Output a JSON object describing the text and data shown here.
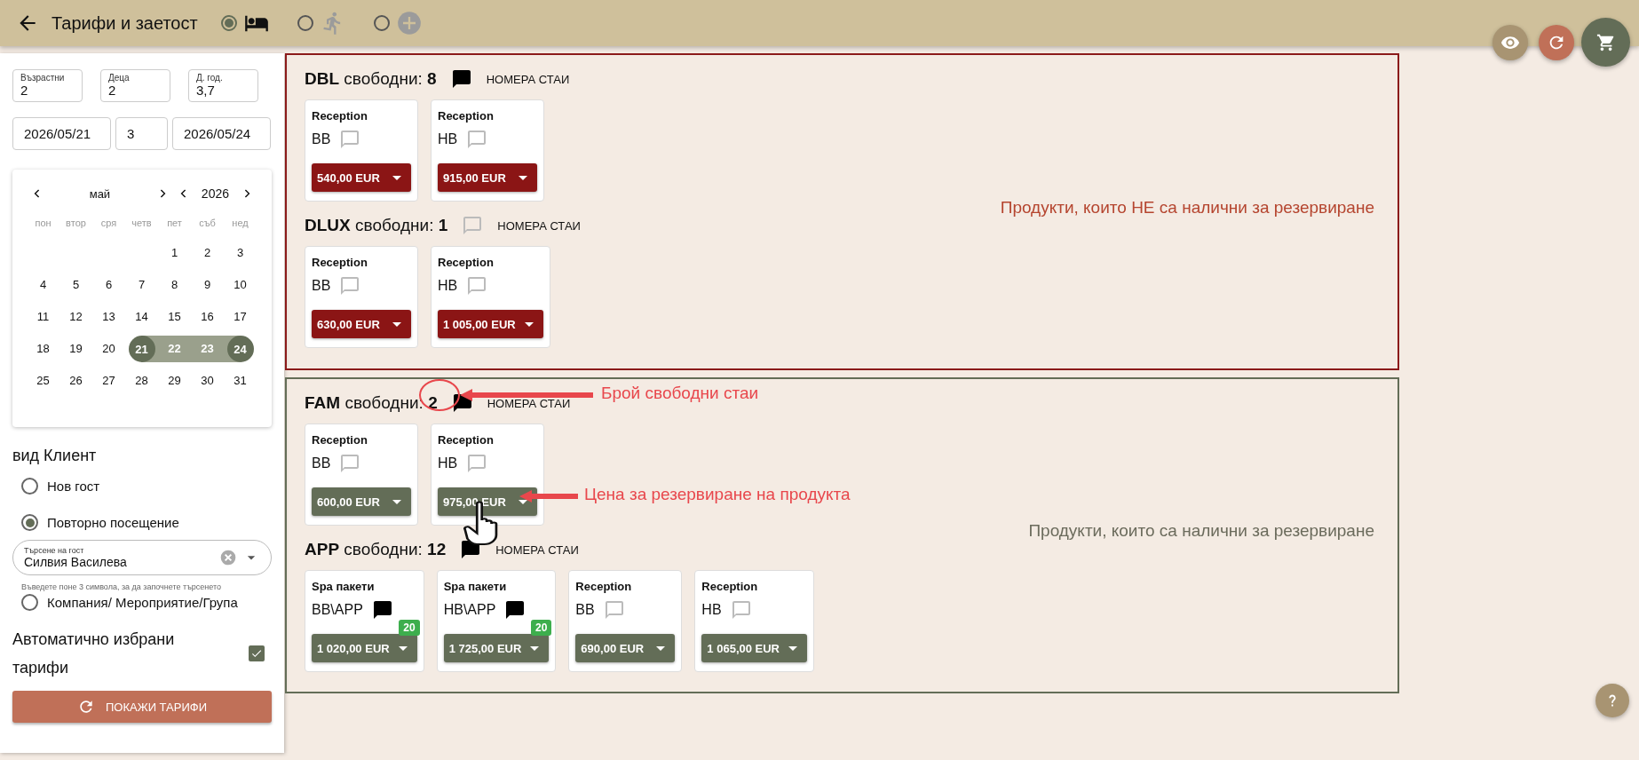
{
  "header": {
    "title": "Тарифи и заетост",
    "modes": [
      {
        "kind": "bed",
        "selected": true,
        "disabled": false
      },
      {
        "kind": "walk",
        "selected": false,
        "disabled": true
      },
      {
        "kind": "add",
        "selected": false,
        "disabled": true
      }
    ]
  },
  "occupancy": [
    {
      "label": "Възрастни",
      "value": "2"
    },
    {
      "label": "Деца",
      "value": "2"
    },
    {
      "label": "Д. год.",
      "value": "3,7"
    }
  ],
  "dates": {
    "arrival": "2026/05/21",
    "nights": "3",
    "departure": "2026/05/24"
  },
  "calendar": {
    "month": "май",
    "year": "2026",
    "weekdays": [
      "пон",
      "втор",
      "сря",
      "четв",
      "пет",
      "съб",
      "нед"
    ],
    "weeks": [
      {
        "days": [
          {
            "day": "1",
            "selected": false,
            "in_range": false
          },
          {
            "day": "2",
            "selected": false,
            "in_range": false
          },
          {
            "day": "3",
            "selected": false,
            "in_range": false
          }
        ]
      },
      {
        "days": [
          {
            "day": "4",
            "selected": false,
            "in_range": false
          },
          {
            "day": "5",
            "selected": false,
            "in_range": false
          },
          {
            "day": "6",
            "selected": false,
            "in_range": false
          },
          {
            "day": "7",
            "selected": false,
            "in_range": false
          },
          {
            "day": "8",
            "selected": false,
            "in_range": false
          },
          {
            "day": "9",
            "selected": false,
            "in_range": false
          },
          {
            "day": "10",
            "selected": false,
            "in_range": false
          }
        ]
      },
      {
        "days": [
          {
            "day": "11",
            "selected": false,
            "in_range": false
          },
          {
            "day": "12",
            "selected": false,
            "in_range": false
          },
          {
            "day": "13",
            "selected": false,
            "in_range": false
          },
          {
            "day": "14",
            "selected": false,
            "in_range": false
          },
          {
            "day": "15",
            "selected": false,
            "in_range": false
          },
          {
            "day": "16",
            "selected": false,
            "in_range": false
          },
          {
            "day": "17",
            "selected": false,
            "in_range": false
          }
        ]
      },
      {
        "days": [
          {
            "day": "18",
            "selected": false,
            "in_range": false
          },
          {
            "day": "19",
            "selected": false,
            "in_range": false
          },
          {
            "day": "20",
            "selected": false,
            "in_range": false
          },
          {
            "day": "21",
            "selected": true,
            "in_range": false
          },
          {
            "day": "22",
            "selected": false,
            "in_range": true
          },
          {
            "day": "23",
            "selected": false,
            "in_range": true
          },
          {
            "day": "24",
            "selected": true,
            "in_range": false
          }
        ]
      },
      {
        "days": [
          {
            "day": "25",
            "selected": false,
            "in_range": false
          },
          {
            "day": "26",
            "selected": false,
            "in_range": false
          },
          {
            "day": "27",
            "selected": false,
            "in_range": false
          },
          {
            "day": "28",
            "selected": false,
            "in_range": false
          },
          {
            "day": "29",
            "selected": false,
            "in_range": false
          },
          {
            "day": "30",
            "selected": false,
            "in_range": false
          },
          {
            "day": "31",
            "selected": false,
            "in_range": false
          }
        ]
      }
    ]
  },
  "client_type": {
    "label": "вид Клиент",
    "options": [
      {
        "kind": "radio",
        "label": "Нов гост",
        "selected": false
      },
      {
        "kind": "radio",
        "label": "Повторно посещение",
        "selected": true
      },
      {
        "kind": "search",
        "label": "Търсене на гост",
        "value": "Силвия Василева",
        "hint": "Въведете поне 3 символа, за да започнете търсенето"
      },
      {
        "kind": "radio",
        "label": "Компания/ Мероприятие/Група",
        "selected": false
      }
    ]
  },
  "auto_tariffs": {
    "label": "Автоматично избрани тарифи",
    "checked": true
  },
  "show_button": "ПОКАЖИ ТАРИФИ",
  "sections": [
    {
      "available": false,
      "note": "Продукти, които НЕ са налични за резервиране",
      "room_types": [
        {
          "heading": "**DBL** свободни: **8**",
          "has_comment": true,
          "rooms_link": "НОМЕРА СТАИ",
          "products": [
            {
              "source": "Reception",
              "board": "BB",
              "has_comment": false,
              "price": "540,00 EUR"
            },
            {
              "source": "Reception",
              "board": "HB",
              "has_comment": false,
              "price": "915,00 EUR"
            }
          ]
        },
        {
          "heading": "**DLUX** свободни: **1**",
          "has_comment": false,
          "rooms_link": "НОМЕРА СТАИ",
          "products": [
            {
              "source": "Reception",
              "board": "BB",
              "has_comment": false,
              "price": "630,00 EUR"
            },
            {
              "source": "Reception",
              "board": "HB",
              "has_comment": false,
              "price": "1 005,00 EUR"
            }
          ]
        }
      ]
    },
    {
      "available": true,
      "note": "Продукти, които са налични за резервиране",
      "room_types": [
        {
          "heading": "**FAM** свободни: **2**",
          "has_comment": true,
          "rooms_link": "НОМЕРА СТАИ",
          "products": [
            {
              "source": "Reception",
              "board": "BB",
              "has_comment": false,
              "price": "600,00 EUR"
            },
            {
              "source": "Reception",
              "board": "HB",
              "has_comment": false,
              "price": "975,00 EUR"
            }
          ]
        },
        {
          "heading": "**APP** свободни: **12**",
          "has_comment": true,
          "rooms_link": "НОМЕРА СТАИ",
          "products": [
            {
              "source": "Spa пакети",
              "board": "BB\\APP",
              "has_comment": true,
              "badge": "20",
              "price": "1 020,00 EUR"
            },
            {
              "source": "Spa пакети",
              "board": "HB\\APP",
              "has_comment": true,
              "badge": "20",
              "price": "1 725,00 EUR"
            },
            {
              "source": "Reception",
              "board": "BB",
              "has_comment": false,
              "price": "690,00 EUR"
            },
            {
              "source": "Reception",
              "board": "HB",
              "has_comment": false,
              "price": "1 065,00 EUR"
            }
          ]
        }
      ]
    }
  ],
  "annotations": [
    {
      "kind": "count",
      "text": "Брой свободни стаи"
    },
    {
      "kind": "price",
      "text": "Цена за резервиране на продукта"
    }
  ]
}
